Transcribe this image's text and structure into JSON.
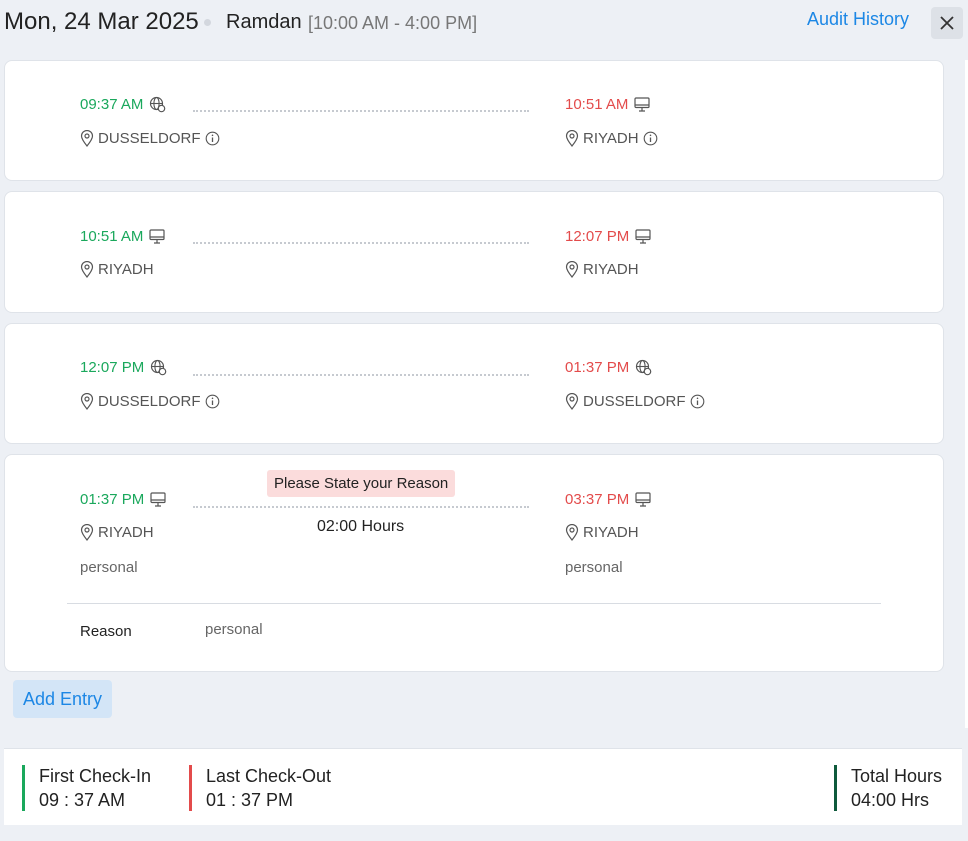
{
  "header": {
    "date": "Mon, 24 Mar 2025",
    "shift_name": "Ramdan",
    "shift_time": "[10:00 AM - 4:00 PM]",
    "audit_label": "Audit History"
  },
  "entries": [
    {
      "in_time": "09:37 AM",
      "in_icon": "globe-icon",
      "in_loc": "DUSSELDORF",
      "in_info": true,
      "out_time": "10:51 AM",
      "out_icon": "monitor-icon",
      "out_loc": "RIYADH",
      "out_info": true
    },
    {
      "in_time": "10:51 AM",
      "in_icon": "monitor-icon",
      "in_loc": "RIYADH",
      "in_info": false,
      "out_time": "12:07 PM",
      "out_icon": "monitor-icon",
      "out_loc": "RIYADH",
      "out_info": false
    },
    {
      "in_time": "12:07 PM",
      "in_icon": "globe-icon",
      "in_loc": "DUSSELDORF",
      "in_info": true,
      "out_time": "01:37 PM",
      "out_icon": "globe-icon",
      "out_loc": "DUSSELDORF",
      "out_info": true
    },
    {
      "in_time": "01:37 PM",
      "in_icon": "monitor-icon",
      "in_loc": "RIYADH",
      "in_note": "personal",
      "out_time": "03:37 PM",
      "out_icon": "monitor-icon",
      "out_loc": "RIYADH",
      "out_note": "personal",
      "reason_tag": "Please State your Reason",
      "duration": "02:00 Hours",
      "reason_label": "Reason",
      "reason_value": "personal"
    }
  ],
  "add_entry_label": "Add Entry",
  "footer": {
    "first_checkin_label": "First Check-In",
    "first_checkin_value": "09 : 37 AM",
    "last_checkout_label": "Last Check-Out",
    "last_checkout_value": "01 : 37 PM",
    "total_hours_label": "Total Hours",
    "total_hours_value": "04:00 Hrs"
  },
  "colors": {
    "check_in": "#1aa85c",
    "check_out": "#e34b4b",
    "link": "#1c87e5",
    "total_bar": "#0f5a3c"
  }
}
